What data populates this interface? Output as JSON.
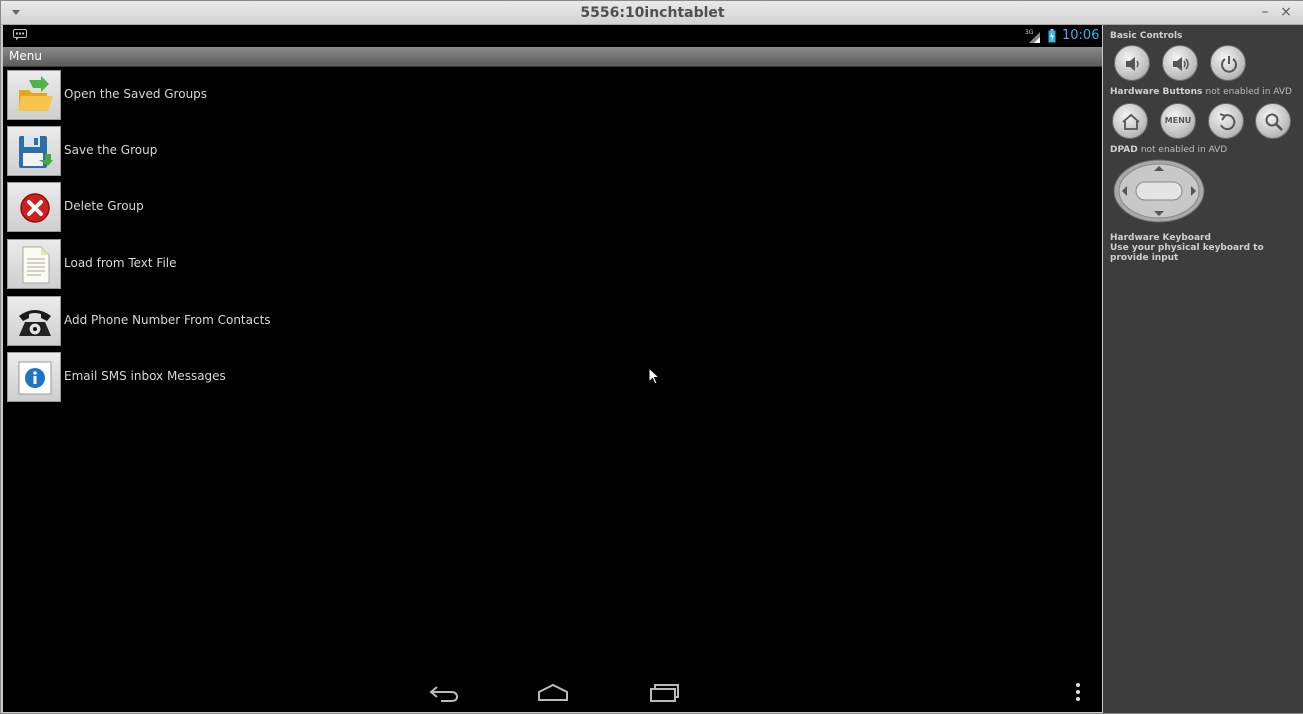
{
  "window": {
    "title": "5556:10inchtablet",
    "minimize_glyph": "–",
    "close_glyph": "×"
  },
  "statusbar": {
    "time": "10:06",
    "network": "3G",
    "time_color": "#33b5e5"
  },
  "menu": {
    "title": "Menu",
    "items": [
      {
        "label": "Open the Saved Groups",
        "icon": "folder-open-icon"
      },
      {
        "label": "Save the Group",
        "icon": "save-disk-icon"
      },
      {
        "label": "Delete Group",
        "icon": "delete-icon"
      },
      {
        "label": "Load from Text File",
        "icon": "text-file-icon"
      },
      {
        "label": "Add Phone Number From Contacts",
        "icon": "telephone-icon"
      },
      {
        "label": "Email SMS inbox Messages",
        "icon": "info-icon"
      }
    ]
  },
  "navbar": {
    "buttons": [
      "back-icon",
      "home-icon",
      "recent-apps-icon"
    ],
    "overflow": "overflow-menu-icon"
  },
  "controls": {
    "basic_title": "Basic Controls",
    "hardware_title": "Hardware Buttons",
    "hardware_note": "not enabled in AVD",
    "dpad_title": "DPAD",
    "dpad_note": "not enabled in AVD",
    "keyboard_title": "Hardware Keyboard",
    "keyboard_note": "Use your physical keyboard to provide input",
    "menu_button_label": "MENU",
    "panel_color": "#3d3d3d"
  }
}
